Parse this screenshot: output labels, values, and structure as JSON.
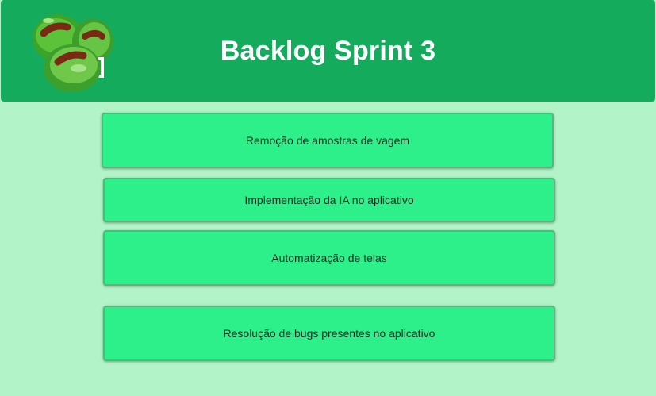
{
  "header": {
    "title": "Backlog Sprint 3",
    "logo_icon": "green-beans-logo-icon",
    "background_color": "#14ab5d"
  },
  "page": {
    "background_color": "#b2f3c8"
  },
  "backlog_items": [
    {
      "label": "Remoção de amostras de vagem"
    },
    {
      "label": "Implementação da IA no aplicativo"
    },
    {
      "label": "Automatização de telas"
    },
    {
      "label": "Resolução de bugs presentes no aplicativo"
    }
  ],
  "card_color": "#2ef08b"
}
